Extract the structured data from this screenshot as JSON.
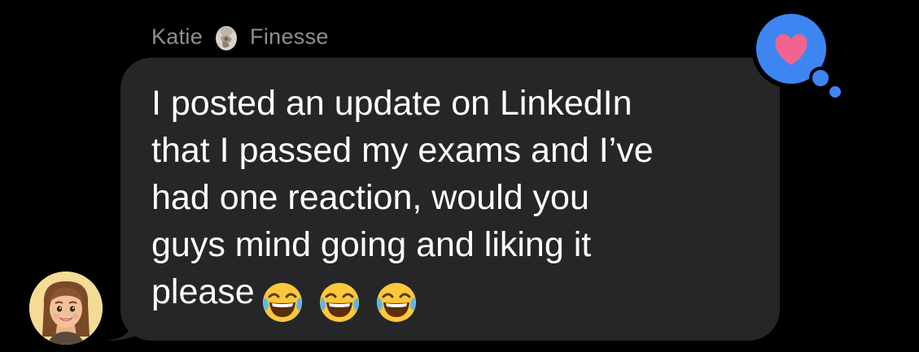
{
  "message": {
    "sender_first": "Katie",
    "sender_last": "Finesse",
    "text": "I posted an update on LinkedIn that I passed my exams and I’ve had one reaction, would you guys mind going and liking it please",
    "lines": [
      "I posted an update on LinkedIn",
      "that I passed my exams and I’ve",
      "had one reaction, would you",
      "guys mind going and liking it",
      "please"
    ],
    "emojis": [
      "face-with-tears-of-joy",
      "face-with-tears-of-joy",
      "face-with-tears-of-joy"
    ]
  },
  "reaction": {
    "type": "heart",
    "badge_color": "#3d86f2",
    "heart_color": "#f0648f"
  },
  "colors": {
    "background": "#000000",
    "bubble": "#262628",
    "sender_name": "#8e8e93",
    "message_text": "#ffffff",
    "avatar_bg": "#f4dc94"
  },
  "avatar": {
    "icon": "memoji-avatar"
  }
}
